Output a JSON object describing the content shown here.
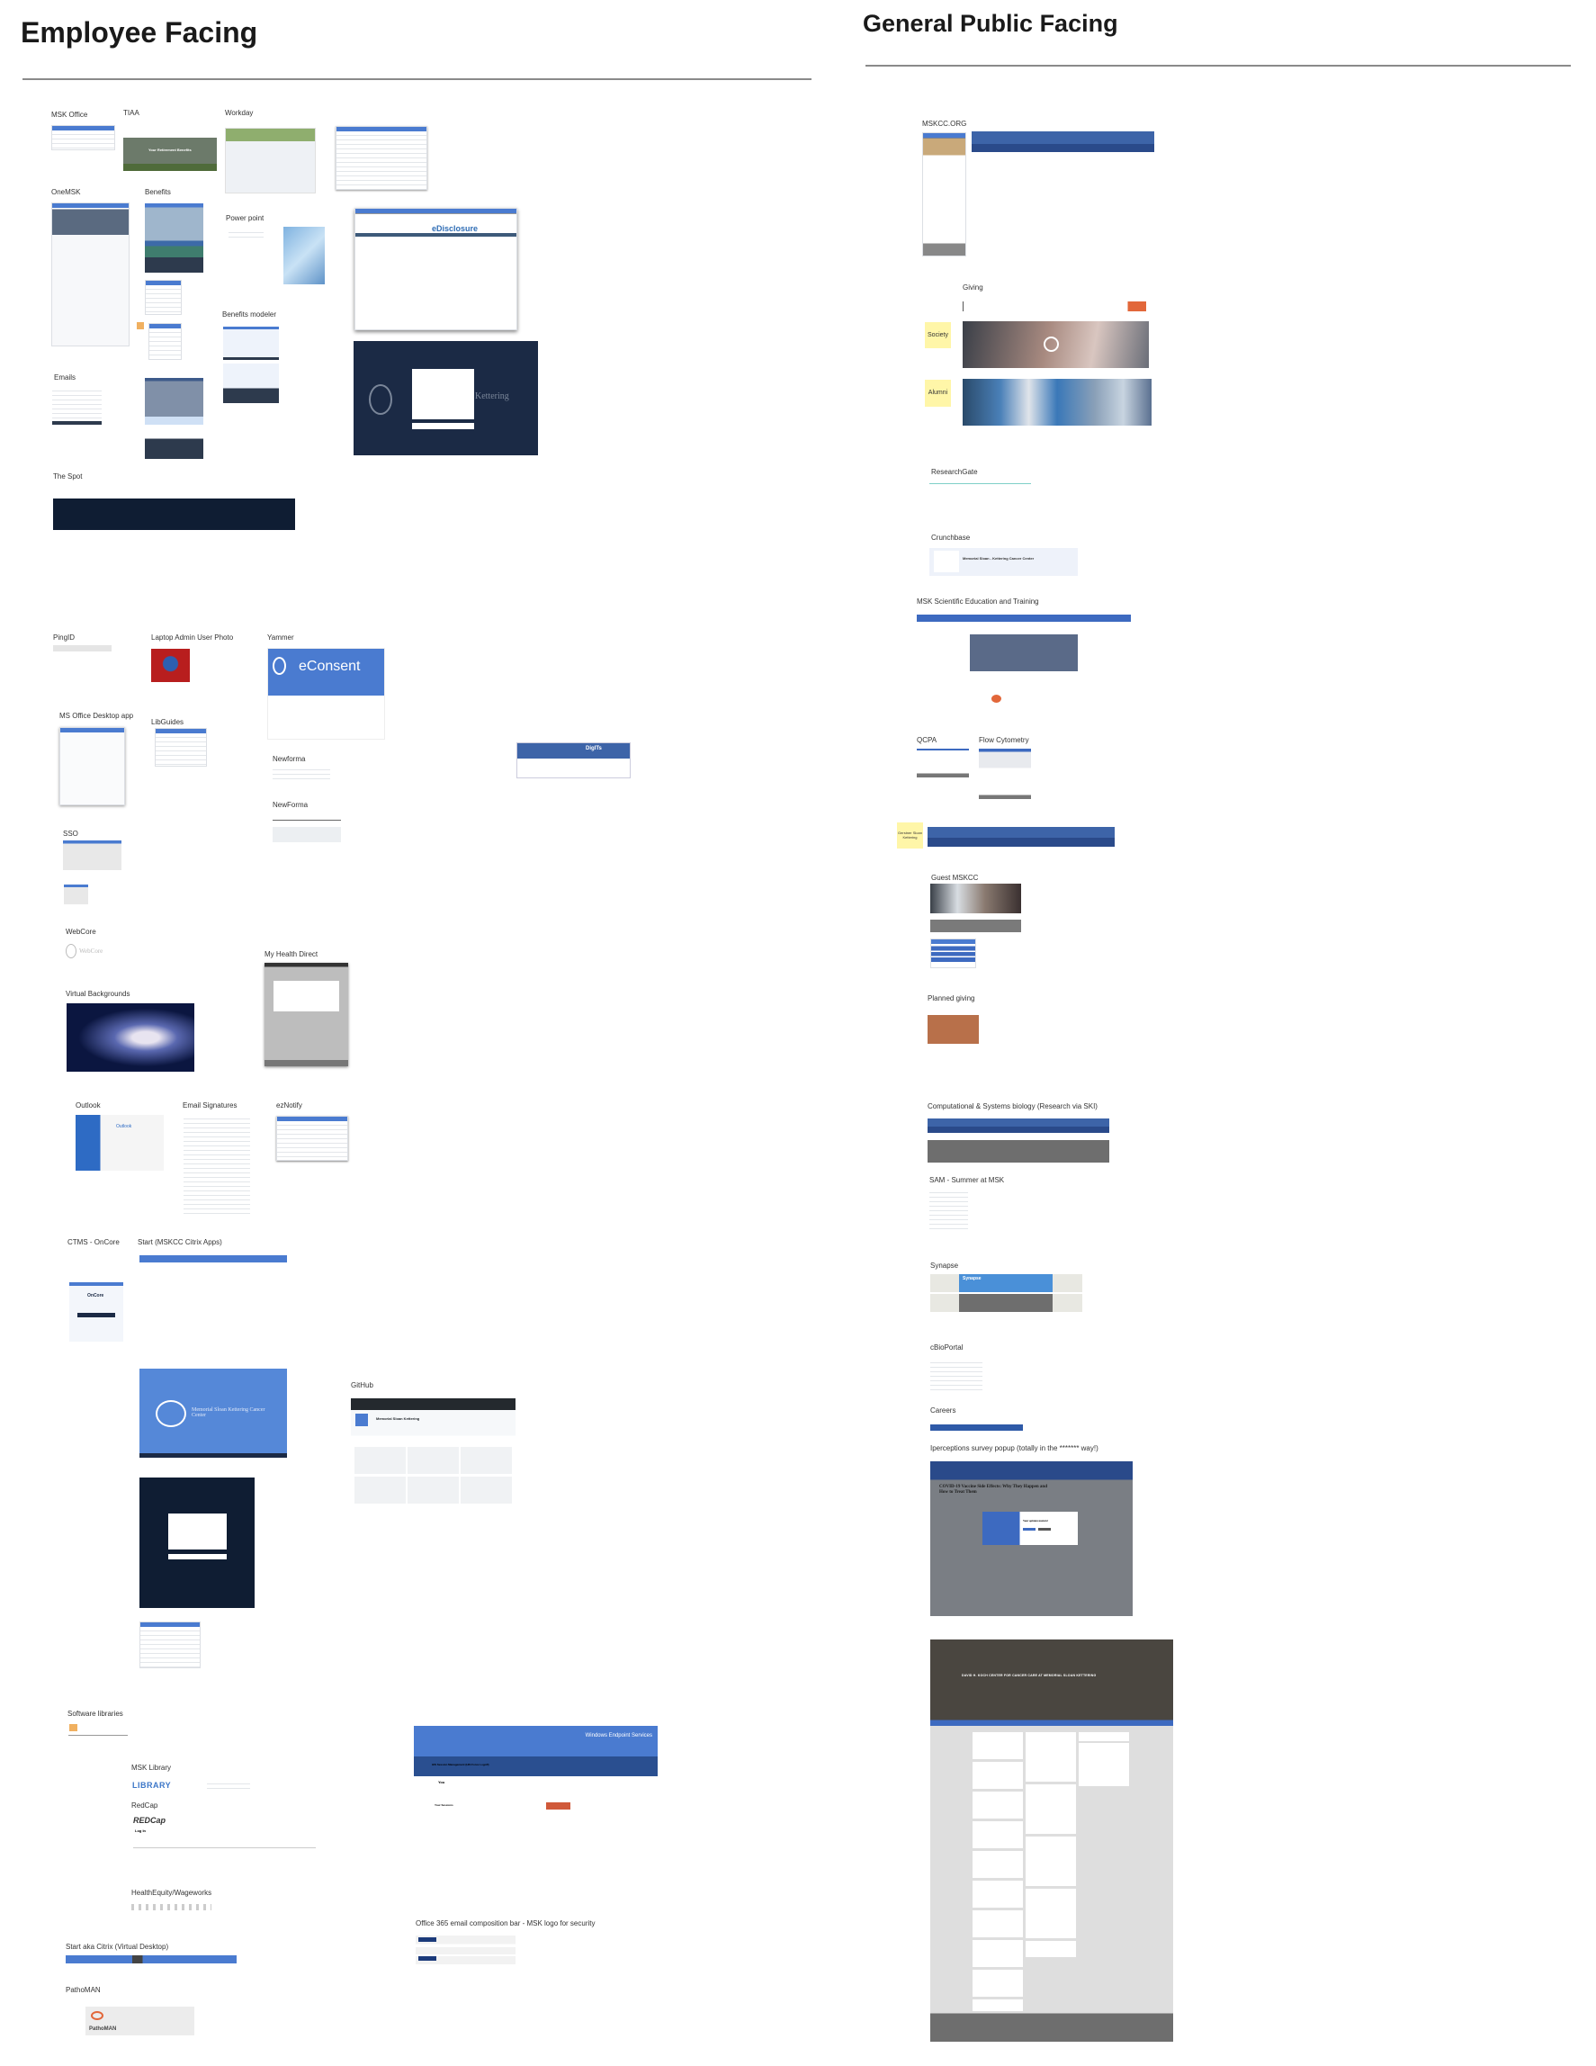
{
  "employee": {
    "title": "Employee Facing",
    "labels": {
      "msk_office": "MSK Office",
      "tiaa": "TIAA",
      "workday": "Workday",
      "onemsk": "OneMSK",
      "benefits": "Benefits",
      "power_point": "Power point",
      "benefits_modeler": "Benefits modeler",
      "emails": "Emails",
      "the_spot": "The Spot",
      "pingid": "PingID",
      "laptop_admin": "Laptop Admin User Photo",
      "yammer": "Yammer",
      "ms_office_desktop": "MS Office Desktop app",
      "libguides": "LibGuides",
      "newforma1": "Newforma",
      "newforma2": "NewForma",
      "sso": "SSO",
      "webcore": "WebCore",
      "my_health_direct": "My Health Direct",
      "virtual_backgrounds": "Virtual Backgrounds",
      "outlook": "Outlook",
      "email_signatures": "Email Signatures",
      "eznotify": "ezNotify",
      "ctms": "CTMS - OnCore",
      "start_citrix_apps": "Start (MSKCC Citrix Apps)",
      "github": "GitHub",
      "software_libraries": "Software libraries",
      "msk_library": "MSK Library",
      "redcap": "RedCap",
      "healthequity": "HealthEquity/Wageworks",
      "office365": "Office 365 email composition bar - MSK logo for security",
      "start_aka_citrix": "Start aka Citrix (Virtual Desktop)",
      "pathoman": "PathoMAN"
    },
    "thumb_text": {
      "tiaa_banner": "Your Retirement Benefits",
      "edisclosure": "eDisclosure",
      "kettering": "Kettering",
      "econsent": "eConsent",
      "digits": "DigITs",
      "webcore_logo": "WebCore",
      "outlook_logo": "Outlook",
      "oncore": "OnCore",
      "msk_name": "Memorial Sloan Kettering Cancer Center",
      "github_org": "Memorial Sloan Kettering",
      "library": "LIBRARY",
      "redcap_logo": "REDCap",
      "redcap_login": "Log In",
      "pathoman_logo": "PathoMAN",
      "windows_endpoint": "Windows Endpoint Services",
      "his_session": "HIS Session Management (HIS Force Logoff)",
      "you": "You",
      "your_sessions": "Your Sessions"
    }
  },
  "public": {
    "title": "General Public Facing",
    "labels": {
      "mskcc_org": "MSKCC.ORG",
      "giving": "Giving",
      "researchgate": "ResearchGate",
      "crunchbase": "Crunchbase",
      "sci_ed": "MSK Scientific Education and Training",
      "qcpa": "QCPA",
      "flow_cytometry": "Flow Cytometry",
      "guest_mskcc": "Guest MSKCC",
      "planned_giving": "Planned giving",
      "comp_bio": "Computational & Systems biology (Research via SKI)",
      "sam": "SAM - Summer at MSK",
      "synapse": "Synapse",
      "cbioportal": "cBioPortal",
      "careers": "Careers",
      "iperceptions": "Iperceptions survey popup (totally in the ******* way!)"
    },
    "stickies": {
      "society": "Society",
      "alumni": "Alumni",
      "gerstner": "Gerstner Sloan Kettering"
    },
    "thumb_text": {
      "crunchbase_name": "Memorial Sloan - Kettering Cancer Center",
      "synapse_logo": "Synapse",
      "covid_headline": "COVID-19 Vaccine Side Effects: Why They Happen and How to Treat Them",
      "popup_title": "Your opinion matters!",
      "koch": "DAVID H. KOCH CENTER FOR CANCER CARE AT MEMORIAL SLOAN KETTERING"
    }
  },
  "colors": {
    "msk_blue": "#4a7bd0",
    "navy": "#1b2a45",
    "sticky_yellow": "#fff6a8",
    "accent_orange": "#e2673a"
  }
}
